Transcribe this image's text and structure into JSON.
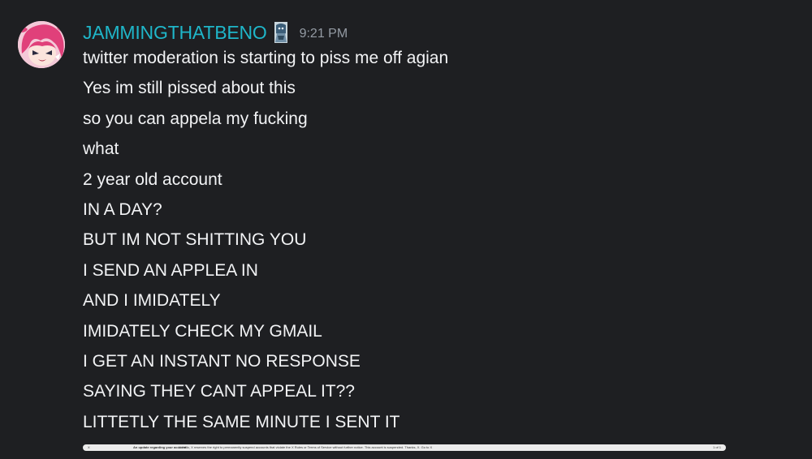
{
  "message_group": {
    "author": "JAMMINGTHATBENO",
    "timestamp": "9:21 PM",
    "avatar": "anime-avatar-pink-hair",
    "role_icon": "character-badge-icon",
    "colors": {
      "background": "#1e1f22",
      "username": "#1fb6c9",
      "message_text": "#f2f3f5",
      "timestamp": "#949ba4"
    },
    "messages": [
      "twitter moderation is starting to piss me off agian",
      "Yes im still pissed about this",
      "so you can appela my fucking",
      "what",
      "2 year old account",
      "IN A DAY?",
      "BUT IM NOT SHITTING YOU",
      "I SEND AN APPLEA IN",
      "AND I IMIDATELY",
      "IMIDATELY CHECK MY GMAIL",
      "I GET AN INSTANT NO RESPONSE",
      "SAYING THEY CANT APPEAL IT??",
      "LITTETLY THE SAME MINUTE I SENT IT"
    ]
  },
  "embed_strip": {
    "left_text": "X",
    "title": "An update regarding your account",
    "body": "X Hello, X reserves the right to permanently suspend accounts that violate the X Rules or Terms of Service without further notice. This account is suspended. Thanks, X. Go to X",
    "right_text": "1 of 1"
  }
}
